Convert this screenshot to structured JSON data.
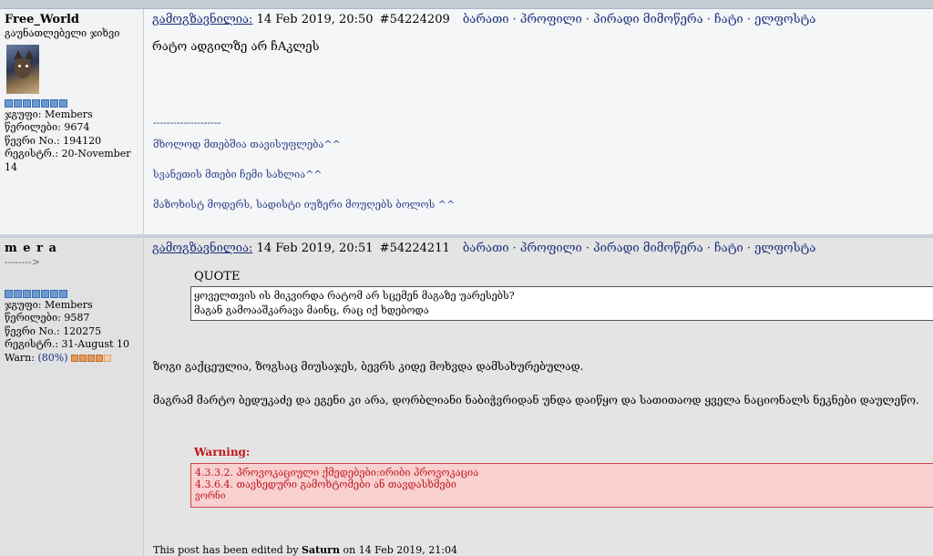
{
  "post1": {
    "author": {
      "name": "Free_World",
      "title": "გაუნათლებელი ჯიხვი",
      "group": "ჯგუფი: Members",
      "posts": "წერილები: 9674",
      "member_no": "წევრი No.: 194120",
      "registered": "რეგისტრ.: 20-November 14"
    },
    "header": {
      "label": "გამოგზავნილია:",
      "date": "14 Feb 2019, 20:50",
      "id": "#54224209",
      "links": "ბარათი · პროფილი · პირადი მიმოწერა · ჩატი · ელფოსტა"
    },
    "body": "რატო ადგილზე არ ჩAკლეს",
    "signature": {
      "separator": "--------------------",
      "line1": "მხოლოდ მთებშია თავისუფლება^^",
      "line2": "სვანეთის მთები ჩემი სახლია^^",
      "line3": "მაზოხისტ მოდერს, სადისტი იუზერი მოუღებს ბოლოს ^^"
    }
  },
  "post2": {
    "author": {
      "name": "m e r a",
      "title": "-------->",
      "group": "ჯგუფი: Members",
      "posts": "წერილები: 9587",
      "member_no": "წევრი No.: 120275",
      "registered": "რეგისტრ.: 31-August 10",
      "warn_label": "Warn:",
      "warn_pct": "(80%)",
      "warn_level": 0.8
    },
    "header": {
      "label": "გამოგზავნილია:",
      "date": "14 Feb 2019, 20:51",
      "id": "#54224211",
      "links": "ბარათი · პროფილი · პირადი მიმოწერა · ჩატი · ელფოსტა"
    },
    "quote": {
      "title": "QUOTE",
      "line1": "ყოველთვის ის მიკვირდა რატომ არ სცემენ მაგაზე უარესებს?",
      "line2": "მაგან გამოააშკარავა მაინც, რაც იქ ხდებოდა"
    },
    "text1": "ზოგი გაქცეულია, ზოგსაც მიუსაჯეს, ბევრს კიდე მოხვდა დამსახურებულად.",
    "text2": "მაგრამ მარტო ბედუკაძე და ეგენი კი არა, დორბლიანი ნაბიჭვრიდან უნდა დაიწყო და სათითაოდ ყველა ნაციონალს ნეკნები დაულეწო.",
    "warning": {
      "title": "Warning:",
      "line1": "4.3.3.2. პროვოკაციული ქმედებები:ირიბი პროვოკაცია",
      "line2": "4.3.6.4. თავხედური გამოხტომები ან თავდასხმები",
      "line3": "ვორნი"
    },
    "edited": {
      "prefix": "This post has been edited by",
      "user": "Saturn",
      "suffix": "on 14 Feb 2019, 21:04"
    }
  }
}
